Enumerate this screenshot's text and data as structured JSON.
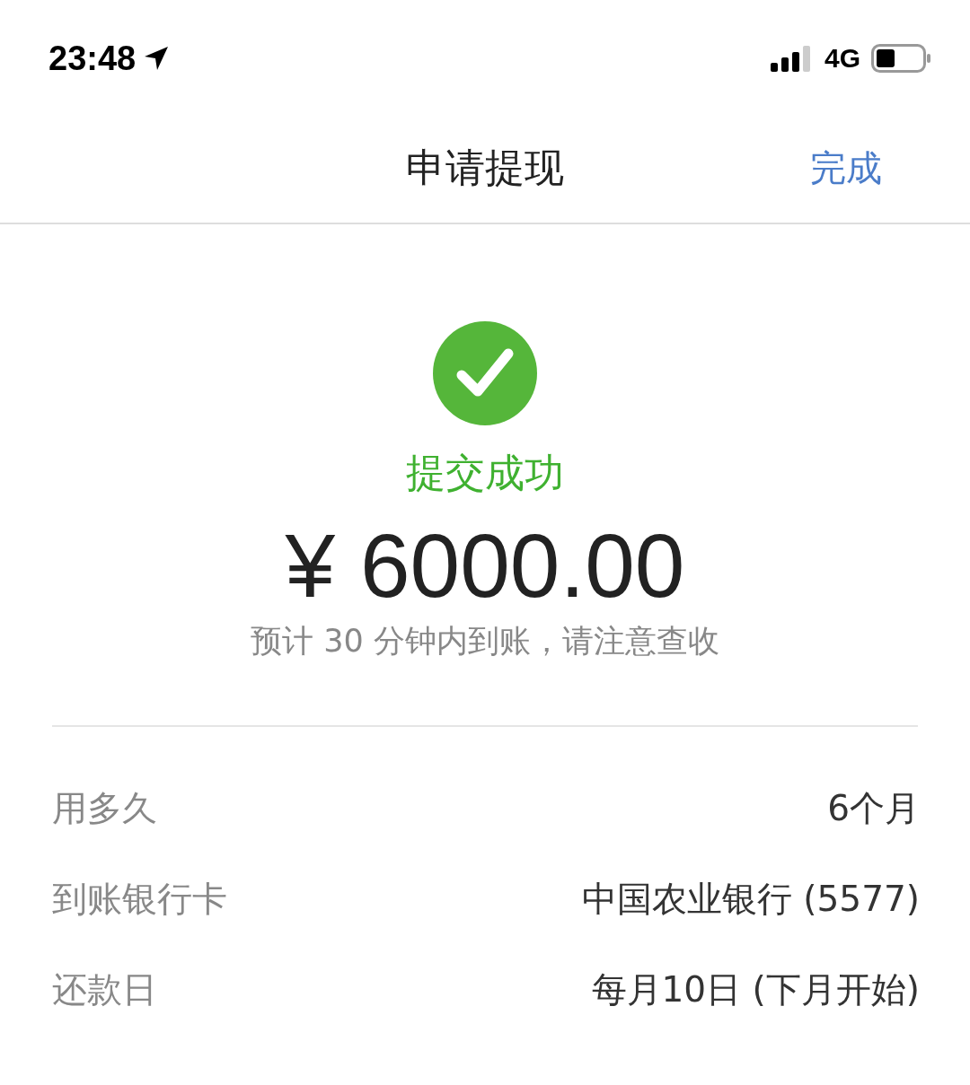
{
  "status_bar": {
    "time": "23:48",
    "network": "4G"
  },
  "nav": {
    "title": "申请提现",
    "action": "完成"
  },
  "result": {
    "status": "提交成功",
    "amount": "¥ 6000.00",
    "note": "预计 30 分钟内到账，请注意查收"
  },
  "details": [
    {
      "label": "用多久",
      "value": "6个月"
    },
    {
      "label": "到账银行卡",
      "value": "中国农业银行 (5577)"
    },
    {
      "label": "还款日",
      "value": "每月10日 (下月开始)"
    }
  ]
}
